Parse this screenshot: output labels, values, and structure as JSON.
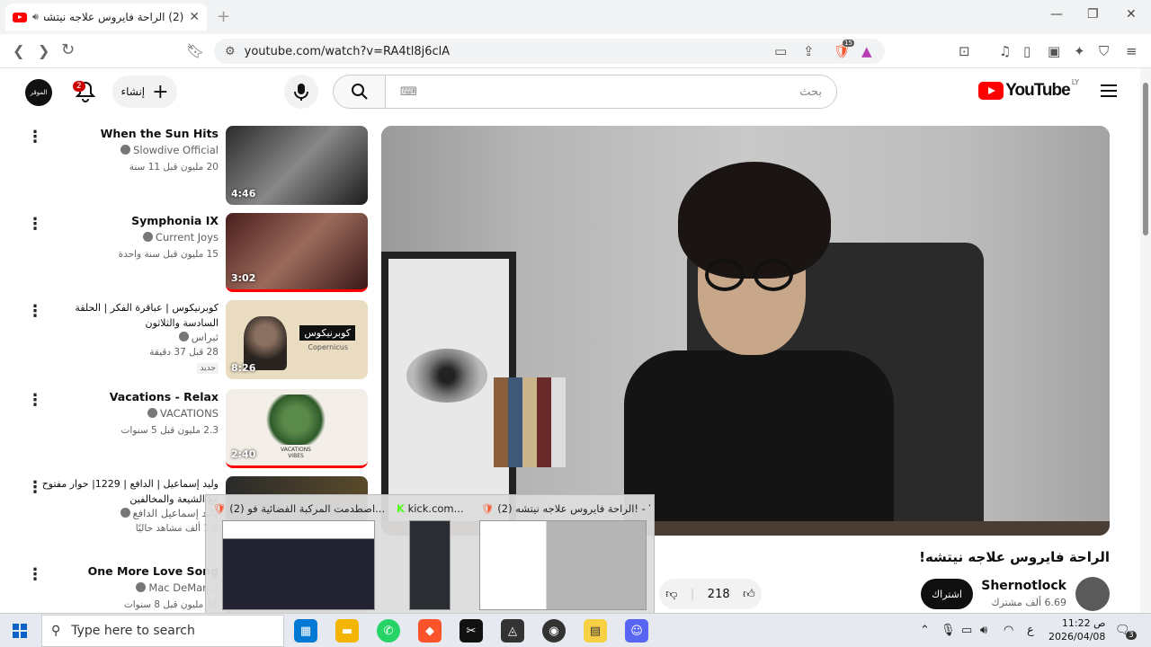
{
  "browser": {
    "tab_title": "(2) الراحة فايروس علاجه نيتشه!",
    "url": "youtube.com/watch?v=RA4tl8j6clA",
    "shields_count": "15"
  },
  "header": {
    "logo_text": "YouTube",
    "logo_country": "LY",
    "search_placeholder": "بحث",
    "create_label": "إنشاء",
    "notifications_count": "2",
    "avatar_text": "الموقر"
  },
  "video": {
    "title": "الراحة فايروس علاجه نيتشه!",
    "channel": "Shernotlock",
    "subscribers": "6.69 ألف مشترك",
    "subscribe_label": "اشتراك",
    "likes": "218"
  },
  "recommendations": [
    {
      "title": "When the Sun Hits",
      "channel": "Slowdive Official",
      "meta": "20 مليون   قبل 11 سنة",
      "duration": "4:46"
    },
    {
      "title": "Symphonia IX",
      "channel": "Current Joys",
      "meta": "15 مليون   قبل سنة واحدة",
      "duration": "3:02"
    },
    {
      "title": "كوبرنيكوس | عباقرة الفكر | الحلقة السادسة والثلاثون",
      "channel": "ثبراس",
      "meta": "28   قبل 37 دقيقة",
      "duration": "8:26",
      "badge": "جديد"
    },
    {
      "title": "Vacations - Relax",
      "channel": "VACATIONS",
      "meta": "2.3 مليون   قبل 5 سنوات",
      "duration": "2:40"
    },
    {
      "title": "وليد إسماعيل | الدافع | 1229| حوار مفتوح مع الشيعة والمخالفين",
      "channel": "وليد إسماعيل الدافع",
      "meta": "1.6 ألف مشاهد حاليًا",
      "duration": ""
    },
    {
      "title": "One More Love Song",
      "channel": "Mac DeMarco",
      "meta": "16 مليون   قبل 8 سنوات",
      "duration": ""
    }
  ],
  "thumbs": {
    "t3_label": "كوبرنيكوس",
    "t3_sub": "Copernicus",
    "t4_label": "VACATIONS VIBES"
  },
  "taskbar_popup": [
    {
      "title": "(2) اصطدمت المركبة الفضائية فو..."
    },
    {
      "title": "kick.com..."
    },
    {
      "title": "(2) الراحة فايروس علاجه نيتشه! - Y..."
    }
  ],
  "taskbar": {
    "search_placeholder": "Type here to search",
    "time": "11:22 ص",
    "date": "2026/04/08",
    "lang": "ع",
    "notif": "3"
  },
  "colors": {
    "accent": "#ff0000",
    "subscribe_bg": "#0f0f0f"
  }
}
